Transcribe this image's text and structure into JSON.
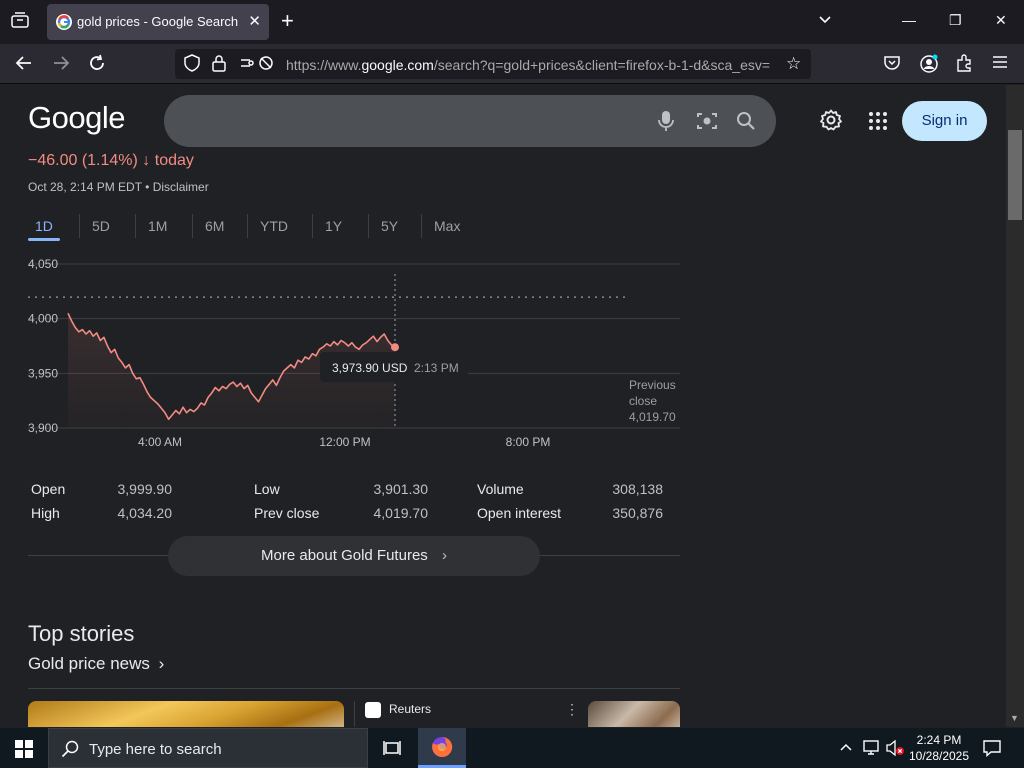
{
  "browser": {
    "tab_title": "gold prices - Google Search",
    "url_prefix": "https://www.",
    "url_domain": "google.com",
    "url_rest": "/search?q=gold+prices&client=firefox-b-1-d&sca_esv=",
    "icons": [
      "tab-list-icon",
      "close-icon",
      "plus-icon",
      "chevron-down-icon",
      "minimize-icon",
      "restore-icon",
      "close-window-icon",
      "back-icon",
      "forward-icon",
      "reload-icon",
      "shield-icon",
      "lock-icon",
      "permissions-icon",
      "bookmark-star-icon",
      "pocket-icon",
      "account-icon",
      "extensions-icon",
      "menu-icon"
    ]
  },
  "header": {
    "logo": "Google",
    "signin_label": "Sign in"
  },
  "quote": {
    "change": "−46.00 (1.14%) ↓ today",
    "date": "Oct 28, 2:14 PM EDT • Disclaimer"
  },
  "ranges": [
    "1D",
    "5D",
    "1M",
    "6M",
    "YTD",
    "1Y",
    "5Y",
    "Max"
  ],
  "active_range": "1D",
  "tooltip": {
    "price": "3,973.90 USD",
    "time": "2:13 PM"
  },
  "chart_data": {
    "type": "line",
    "y_ticks": [
      "4,050",
      "4,000",
      "3,950",
      "3,900"
    ],
    "x_ticks": [
      "4:00 AM",
      "12:00 PM",
      "8:00 PM"
    ],
    "ylim": [
      3900,
      4050
    ],
    "previous_close": {
      "label_1": "Previous",
      "label_2": "close",
      "value": "4,019.70",
      "y": 4019.7
    },
    "series": [
      {
        "y": [
          4005,
          3998,
          3992,
          3988,
          3990,
          3986,
          3989,
          3984,
          3987,
          3980,
          3983,
          3975,
          3969,
          3972,
          3964,
          3960,
          3955,
          3958,
          3950,
          3945,
          3946,
          3940,
          3933,
          3928,
          3925,
          3922,
          3918,
          3914,
          3908,
          3912,
          3916,
          3913,
          3919,
          3914,
          3917,
          3915,
          3918,
          3923,
          3921,
          3928,
          3932,
          3937,
          3934,
          3938,
          3936,
          3940,
          3942,
          3938,
          3941,
          3936,
          3939,
          3932,
          3928,
          3924,
          3930,
          3936,
          3940,
          3944,
          3939,
          3946,
          3952,
          3955,
          3958,
          3955,
          3962,
          3960,
          3965,
          3963,
          3968,
          3966,
          3972,
          3974,
          3977,
          3975,
          3979,
          3976,
          3980,
          3978,
          3975,
          3978,
          3974,
          3972,
          3976,
          3978,
          3981,
          3984,
          3979,
          3983,
          3986,
          3980,
          3976,
          3973.9
        ]
      }
    ]
  },
  "stats": [
    {
      "label": "Open",
      "value": "3,999.90"
    },
    {
      "label": "High",
      "value": "4,034.20"
    },
    {
      "label": "Low",
      "value": "3,901.30"
    },
    {
      "label": "Prev close",
      "value": "4,019.70"
    },
    {
      "label": "Volume",
      "value": "308,138"
    },
    {
      "label": "Open interest",
      "value": "350,876"
    }
  ],
  "more_label": "More about Gold Futures",
  "stories": {
    "heading": "Top stories",
    "subheading": "Gold price news",
    "source": "Reuters"
  },
  "taskbar": {
    "search_placeholder": "Type here to search",
    "time": "2:24 PM",
    "date": "10/28/2025"
  }
}
